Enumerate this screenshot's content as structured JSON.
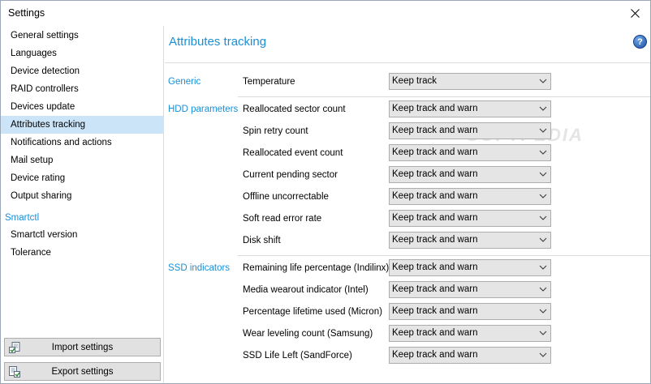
{
  "window": {
    "title": "Settings"
  },
  "sidebar": {
    "items": [
      {
        "label": "General settings",
        "active": false
      },
      {
        "label": "Languages",
        "active": false
      },
      {
        "label": "Device detection",
        "active": false
      },
      {
        "label": "RAID controllers",
        "active": false
      },
      {
        "label": "Devices update",
        "active": false
      },
      {
        "label": "Attributes tracking",
        "active": true
      },
      {
        "label": "Notifications and actions",
        "active": false
      },
      {
        "label": "Mail setup",
        "active": false
      },
      {
        "label": "Device rating",
        "active": false
      },
      {
        "label": "Output sharing",
        "active": false
      }
    ],
    "smartctl_section": "Smartctl",
    "smartctl_items": [
      {
        "label": "Smartctl version"
      },
      {
        "label": "Tolerance"
      }
    ],
    "import_label": "Import settings",
    "export_label": "Export settings"
  },
  "main": {
    "title": "Attributes tracking",
    "help_glyph": "?",
    "watermark": "SOFTPEDIA",
    "groups": [
      {
        "name": "Generic",
        "rows": [
          {
            "label": "Temperature",
            "value": "Keep track"
          }
        ]
      },
      {
        "name": "HDD parameters",
        "rows": [
          {
            "label": "Reallocated sector count",
            "value": "Keep track and warn"
          },
          {
            "label": "Spin retry count",
            "value": "Keep track and warn"
          },
          {
            "label": "Reallocated event count",
            "value": "Keep track and warn"
          },
          {
            "label": "Current pending sector",
            "value": "Keep track and warn"
          },
          {
            "label": "Offline uncorrectable",
            "value": "Keep track and warn"
          },
          {
            "label": "Soft read error rate",
            "value": "Keep track and warn"
          },
          {
            "label": "Disk shift",
            "value": "Keep track and warn"
          }
        ]
      },
      {
        "name": "SSD indicators",
        "rows": [
          {
            "label": "Remaining life percentage (Indilinx)",
            "value": "Keep track and warn"
          },
          {
            "label": "Media wearout indicator (Intel)",
            "value": "Keep track and warn"
          },
          {
            "label": "Percentage lifetime used (Micron)",
            "value": "Keep track and warn"
          },
          {
            "label": "Wear leveling count (Samsung)",
            "value": "Keep track and warn"
          },
          {
            "label": "SSD Life Left (SandForce)",
            "value": "Keep track and warn"
          }
        ]
      }
    ]
  },
  "colors": {
    "accent": "#1a8fd6",
    "selection": "#cce4f7"
  }
}
